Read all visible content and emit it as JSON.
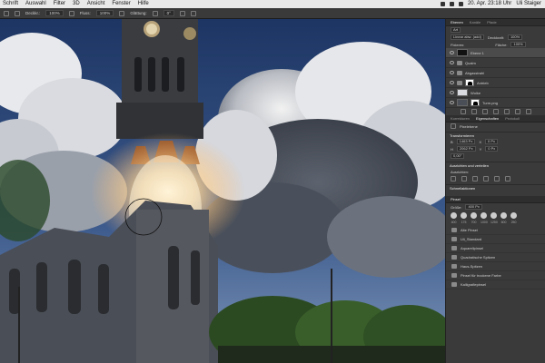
{
  "menubar": {
    "items": [
      "Schrift",
      "Auswahl",
      "Filter",
      "3D",
      "Ansicht",
      "Fenster",
      "Hilfe"
    ],
    "clock": "20. Apr.  23:18 Uhr",
    "user": "Uli Staiger"
  },
  "options": {
    "opacity_label": "Deckkr.:",
    "opacity_value": "100%",
    "flow_label": "Fluss:",
    "flow_value": "100%",
    "smooth_label": "Glättung:",
    "angle_value": "0°"
  },
  "layers_panel": {
    "tabs": [
      "Ebenen",
      "Kanäle",
      "Pfade"
    ],
    "filter": "Art",
    "blend_mode": "Linear abw. (add)",
    "opacity_label": "Deckkraft:",
    "opacity_value": "100%",
    "lock_label": "Fixieren:",
    "fill_label": "Fläche:",
    "fill_value": "100%",
    "layers": [
      {
        "name": "Ebene 1",
        "selected": true
      },
      {
        "name": "Qualm",
        "selected": false
      },
      {
        "name": "Abgasstrahl",
        "selected": false
      },
      {
        "name": "Antrieb",
        "selected": false
      },
      {
        "name": "Wolke",
        "selected": false
      },
      {
        "name": "Turm.png",
        "selected": false
      }
    ]
  },
  "properties_panel": {
    "tabs": [
      "Korrekturen",
      "Eigenschaften",
      "Protokoll"
    ],
    "type": "Pixelebene",
    "transform_title": "Transformieren",
    "w_value": "1463 Px",
    "h_value": "2062 Px",
    "x_value": "0 Px",
    "y_value": "0 Px",
    "angle_value": "0,00°",
    "align_title": "Ausrichten und verteilen",
    "align_sub": "Ausrichten:",
    "quick_title": "Schnellaktionen"
  },
  "brush_panel": {
    "title": "Pinsel",
    "size_label": "Größe:",
    "size_value": "400 Px",
    "presets": [
      "400",
      "175",
      "700",
      "1000",
      "1250",
      "600",
      "250"
    ],
    "folders": [
      "Alte Pinsel",
      "Uli_Standard",
      "Aquarellpinsel",
      "Quadratische Spitzen",
      "Haus-Spitzen",
      "Pinsel für trockene Farbe",
      "Kalligrafiepinsel"
    ]
  },
  "colors": {
    "sky": "#223a66",
    "panel": "#3a3a3a",
    "glow": "#ffd89a"
  }
}
